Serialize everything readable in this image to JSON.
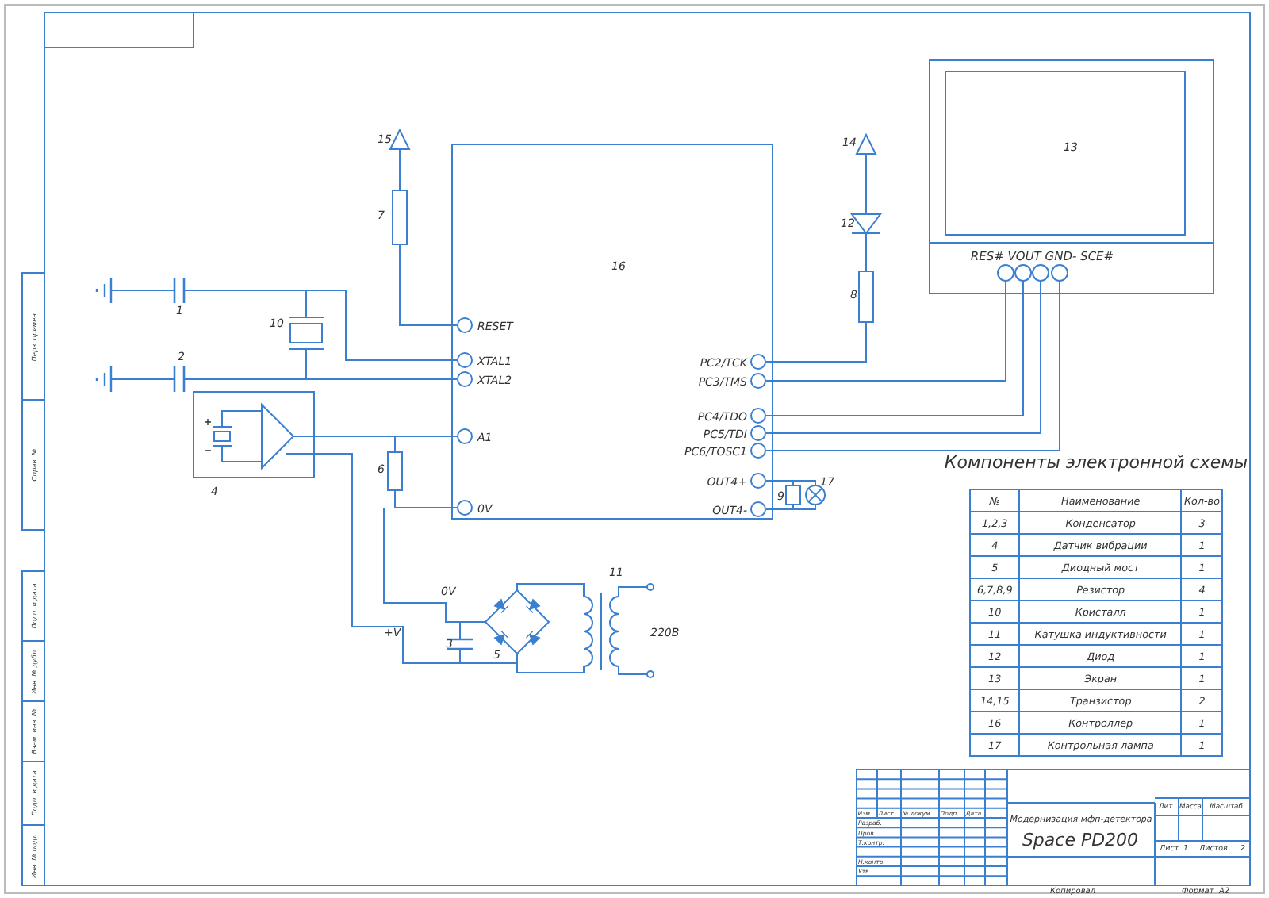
{
  "sheet": {
    "side_stamps": [
      "Перв. примен.",
      "Справ. №",
      "Подп. и дата",
      "Инв. № дубл.",
      "Взам. инв. №",
      "Подп. и дата",
      "Инв. № подл."
    ]
  },
  "schematic": {
    "controller": {
      "ref": "16",
      "left_pins": [
        "RESET",
        "XTAL1",
        "XTAL2",
        "A1",
        "0V"
      ],
      "right_pins": [
        "PC2/TCK",
        "PC3/TMS",
        "PC4/TDO",
        "PC5/TDI",
        "PC6/TOSC1",
        "OUT4+",
        "OUT4-"
      ]
    },
    "display": {
      "ref": "13",
      "pins": "RES# VOUT GND- SCE#"
    },
    "components": [
      {
        "kind": "transistor",
        "ref": "15"
      },
      {
        "kind": "resistor",
        "ref": "7"
      },
      {
        "kind": "capacitor",
        "ref": "1"
      },
      {
        "kind": "crystal",
        "ref": "10"
      },
      {
        "kind": "capacitor",
        "ref": "2"
      },
      {
        "kind": "sensor",
        "ref": "4"
      },
      {
        "kind": "resistor",
        "ref": "6"
      },
      {
        "kind": "transistor",
        "ref": "14"
      },
      {
        "kind": "diode",
        "ref": "12"
      },
      {
        "kind": "resistor",
        "ref": "8"
      },
      {
        "kind": "resistor",
        "ref": "9"
      },
      {
        "kind": "lamp",
        "ref": "17"
      },
      {
        "kind": "capacitor",
        "ref": "3"
      },
      {
        "kind": "bridge",
        "ref": "5"
      },
      {
        "kind": "inductor",
        "ref": "11"
      }
    ],
    "net_labels": [
      "0V",
      "+V",
      "220В"
    ]
  },
  "table": {
    "title": "Компоненты электронной схемы",
    "columns": [
      "№",
      "Наименование",
      "Кол-во"
    ],
    "rows": [
      [
        "1,2,3",
        "Конденсатор",
        "3"
      ],
      [
        "4",
        "Датчик вибрации",
        "1"
      ],
      [
        "5",
        "Диодный мост",
        "1"
      ],
      [
        "6,7,8,9",
        "Резистор",
        "4"
      ],
      [
        "10",
        "Кристалл",
        "1"
      ],
      [
        "11",
        "Катушка индуктивности",
        "1"
      ],
      [
        "12",
        "Диод",
        "1"
      ],
      [
        "13",
        "Экран",
        "1"
      ],
      [
        "14,15",
        "Транзистор",
        "2"
      ],
      [
        "16",
        "Контроллер",
        "1"
      ],
      [
        "17",
        "Контрольная лампа",
        "1"
      ]
    ]
  },
  "title_block": {
    "columns": [
      "Изм.",
      "Лист",
      "№ докум.",
      "Подп.",
      "Дата"
    ],
    "roles": [
      "Разраб.",
      "Пров.",
      "Т.контр.",
      "Н.контр.",
      "Утв."
    ],
    "title": "Модернизация мфп-детектора",
    "code": "Space PD200",
    "fields": [
      "Лит.",
      "Масса",
      "Масштаб"
    ],
    "sheet": {
      "label": "Лист",
      "value": "1"
    },
    "sheets": {
      "label": "Листов",
      "value": "2"
    },
    "copied": "Копировал",
    "format": "Формат  A2"
  }
}
